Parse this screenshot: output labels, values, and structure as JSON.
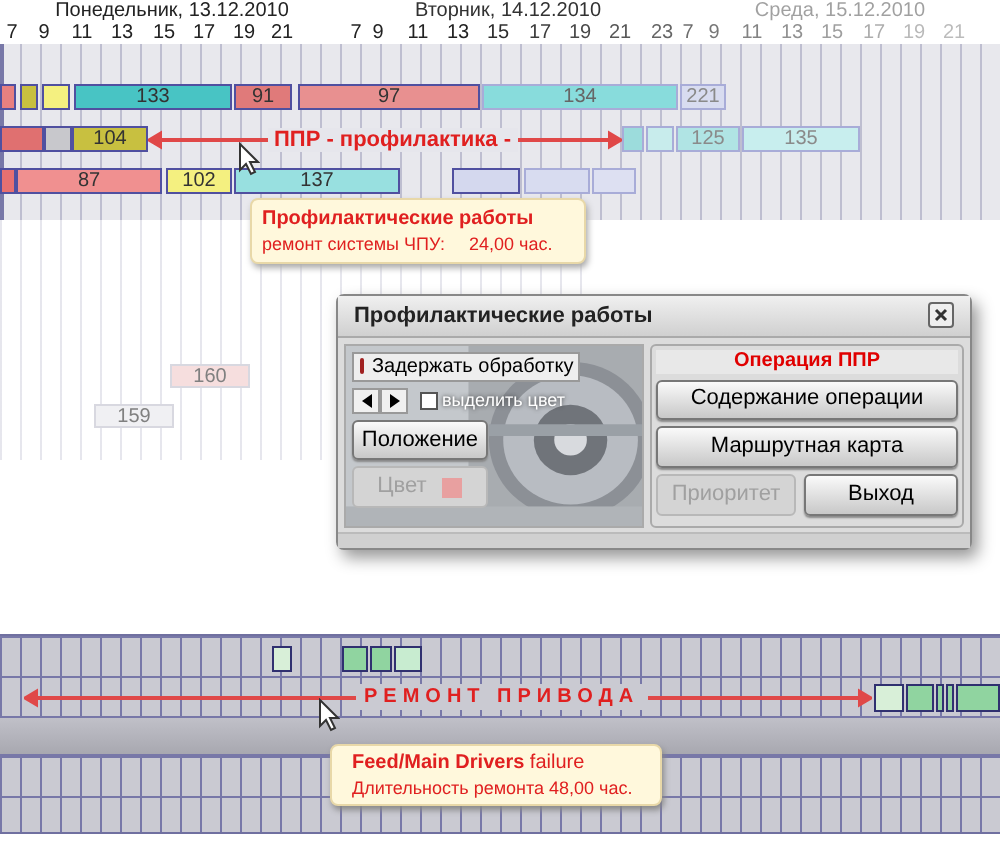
{
  "schedule": {
    "days": [
      "Понедельник, 13.12.2010",
      "Вторник, 14.12.2010",
      "Среда, 15.12.2010"
    ],
    "hours": [
      "7",
      "9",
      "11",
      "13",
      "15",
      "17",
      "19",
      "21",
      "7",
      "9",
      "11",
      "13",
      "15",
      "17",
      "19",
      "21",
      "23",
      "7",
      "9",
      "11",
      "13",
      "15",
      "17",
      "19",
      "21"
    ],
    "rows": [
      {
        "bars": [
          {
            "color": "#e88080"
          },
          {
            "color": "#c8c040"
          },
          {
            "color": "#f4f080"
          },
          {
            "label": "133",
            "color": "#48c4c4"
          },
          {
            "label": "91",
            "color": "#e07a7a"
          },
          {
            "label": "97",
            "color": "#e89090"
          },
          {
            "label": "134",
            "color": "#88dcdc"
          },
          {
            "label": "221",
            "color": "#d8dcf0"
          }
        ]
      },
      {
        "bars": [
          {
            "color": "#e07070"
          },
          {
            "color": "#c8c8cc"
          },
          {
            "label": "104",
            "color": "#c8c040"
          },
          {
            "color": "#9cdcdc"
          },
          {
            "color": "#c8ecec"
          },
          {
            "label": "125",
            "color": "#b0e4e4"
          },
          {
            "label": "135",
            "color": "#c8eeee"
          }
        ]
      },
      {
        "bars": [
          {
            "color": "#e87070"
          },
          {
            "label": "87",
            "color": "#f09090"
          },
          {
            "label": "102",
            "color": "#f4f080"
          },
          {
            "label": "137",
            "color": "#98e0e0"
          },
          {
            "color": "#d4d8ee"
          },
          {
            "color": "#d8dcf0"
          },
          {
            "color": "#dde0f2"
          }
        ]
      }
    ],
    "marker": {
      "label": "ППР - профилактика -"
    },
    "tooltip": {
      "title": "Профилактические работы",
      "detail": "ремонт системы ЧПУ:",
      "value": "24,00 час."
    },
    "extra_blocks": [
      {
        "label": "160",
        "color": "#f6dede"
      },
      {
        "label": "159",
        "color": "#f0f0f3"
      }
    ]
  },
  "dialog": {
    "title": "Профилактические работы",
    "hold_button": {
      "label": "Задержать обработку"
    },
    "highlight_color": {
      "label": "выделить цвет",
      "checked": false
    },
    "position_button": {
      "label": "Положение",
      "disabled": false
    },
    "color_button": {
      "label": "Цвет",
      "disabled": true
    },
    "group_title": "Операция ППР",
    "buttons": [
      {
        "label": "Содержание операции",
        "disabled": false
      },
      {
        "label": "Маршрутная карта",
        "disabled": false
      },
      {
        "label": "Приоритет",
        "disabled": true
      },
      {
        "label": "Выход",
        "disabled": false
      }
    ]
  },
  "repair_schedule": {
    "marker": {
      "label": "РЕМОНТ ПРИВОДА"
    },
    "tooltip": {
      "title": "**Feed/Main Drivers** failure",
      "detail": "Длительность ремонта 48,00 час."
    }
  }
}
